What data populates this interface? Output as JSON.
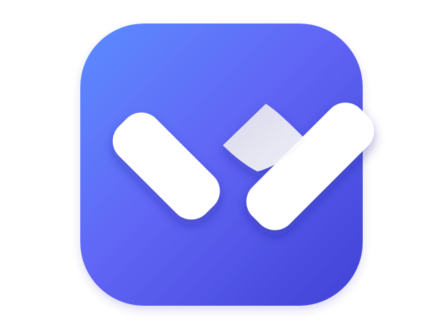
{
  "app_icon": {
    "name": "check-heart-app-icon",
    "gradient_start": "#5B8CFF",
    "gradient_mid": "#6166F5",
    "gradient_end": "#3F41D6",
    "glyph_color": "#FFFFFF",
    "glyph_shadow": "#D9D9DE",
    "background": "#FFFFFF"
  }
}
